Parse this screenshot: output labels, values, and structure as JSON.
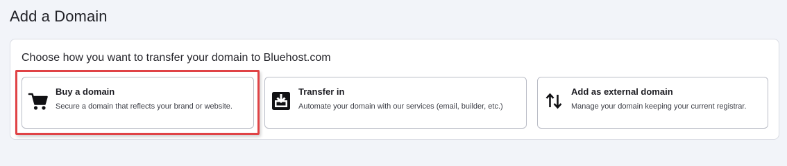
{
  "page": {
    "title": "Add a Domain"
  },
  "panel": {
    "heading": "Choose how you want to transfer your domain to Bluehost.com"
  },
  "options": [
    {
      "icon": "cart-icon",
      "title": "Buy a domain",
      "description": "Secure a domain that reflects your brand or website."
    },
    {
      "icon": "transfer-in-icon",
      "title": "Transfer in",
      "description": "Automate your domain with our services (email, builder, etc.)"
    },
    {
      "icon": "up-down-arrows-icon",
      "title": "Add as external domain",
      "description": "Manage your domain keeping your current registrar."
    }
  ],
  "colors": {
    "highlight": "#e04346",
    "background": "#f2f4f9",
    "card_border": "#b9bcc6"
  }
}
